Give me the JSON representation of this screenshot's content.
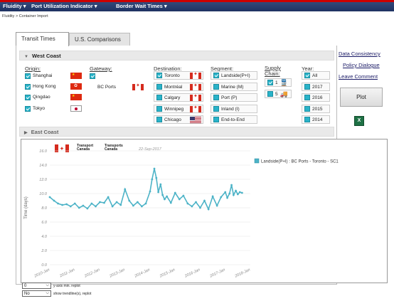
{
  "nav": {
    "menus": [
      "Fluidity ▾",
      "Port Utilization Indicator ▾",
      "Border Wait Times ▾"
    ]
  },
  "breadcrumb": "Fluidity > Container Import",
  "tabs": [
    "Transit Times",
    "U.S. Comparisons"
  ],
  "sections": {
    "west": "West Coast",
    "east": "East Coast"
  },
  "columns": {
    "origin": "Origin:",
    "gateway": "Gateway:",
    "destination": "Destination:",
    "segment": "Segment:",
    "supply": "Supply Chain:",
    "year": "Year:"
  },
  "origins": [
    {
      "label": "Shanghai",
      "checked": true,
      "flag": "china-flag"
    },
    {
      "label": "Hong Kong",
      "checked": true,
      "flag": "hong-kong-flag"
    },
    {
      "label": "Qingdao",
      "checked": true,
      "flag": "china-flag"
    },
    {
      "label": "Tokyo",
      "checked": true,
      "flag": "japan-flag"
    }
  ],
  "gateway": {
    "label": "BC Ports",
    "checked": true,
    "flag": "canada-flag"
  },
  "destinations": [
    {
      "label": "Toronto",
      "checked": true,
      "flag": "canada-flag"
    },
    {
      "label": "Montréal",
      "checked": false,
      "flag": "canada-flag"
    },
    {
      "label": "Calgary",
      "checked": false,
      "flag": "canada-flag"
    },
    {
      "label": "Winnipeg",
      "checked": false,
      "flag": "canada-flag"
    },
    {
      "label": "Chicago",
      "checked": false,
      "flag": "us-flag"
    }
  ],
  "segments": [
    {
      "label": "Landside(P+I)",
      "checked": true
    },
    {
      "label": "Marine (M)",
      "checked": false
    },
    {
      "label": "Port (P)",
      "checked": false
    },
    {
      "label": "Inland (I)",
      "checked": false
    },
    {
      "label": "End-to-End",
      "checked": false
    }
  ],
  "supply": [
    {
      "label": "1",
      "checked": true,
      "icon": "train-icon"
    },
    {
      "label": "5",
      "checked": false,
      "icon": "truck-icon"
    }
  ],
  "years": [
    {
      "label": "All",
      "checked": true
    },
    {
      "label": "2017",
      "checked": false
    },
    {
      "label": "2016",
      "checked": false
    },
    {
      "label": "2015",
      "checked": false
    },
    {
      "label": "2014",
      "checked": false
    }
  ],
  "side": {
    "links": [
      "Data Consistency",
      "Policy Dialogue",
      "Leave Comment"
    ],
    "plot": "Plot",
    "excel": "X"
  },
  "chart_header": {
    "tc_en": "Transport\nCanada",
    "tc_fr": "Transports\nCanada",
    "date": "22-Sep-2017"
  },
  "controls": {
    "ymin_value": "0",
    "ymin_label": "y-axis min. replot",
    "trend_value": "No",
    "trend_label": "show trendline(s), replot"
  },
  "chart_data": {
    "type": "line",
    "ylabel": "Time (days)",
    "ylim": [
      0,
      16
    ],
    "yticks": [
      "0.0",
      "2.0",
      "4.0",
      "6.0",
      "8.0",
      "10.0",
      "12.0",
      "14.0",
      "16.0"
    ],
    "xticks": [
      "2010-Jan",
      "2011-Jan",
      "2012-Jan",
      "2013-Jan",
      "2014-Jan",
      "2015-Jan",
      "2016-Jan",
      "2017-Jan",
      "2018-Jan"
    ],
    "xlim": [
      2010.0,
      2018.0
    ],
    "series": [
      {
        "name": "Landside(P+I) : BC Ports - Toronto - SC1",
        "color": "#4db3c7",
        "x": [
          2010.0,
          2010.17,
          2010.33,
          2010.5,
          2010.67,
          2010.83,
          2011.0,
          2011.17,
          2011.33,
          2011.5,
          2011.67,
          2011.83,
          2012.0,
          2012.17,
          2012.33,
          2012.5,
          2012.67,
          2012.83,
          2013.0,
          2013.17,
          2013.33,
          2013.5,
          2013.67,
          2013.83,
          2014.0,
          2014.08,
          2014.17,
          2014.25,
          2014.33,
          2014.42,
          2014.5,
          2014.58,
          2014.67,
          2014.83,
          2015.0,
          2015.17,
          2015.33,
          2015.5,
          2015.67,
          2015.83,
          2016.0,
          2016.17,
          2016.33,
          2016.5,
          2016.67,
          2016.83,
          2017.0,
          2017.08,
          2017.17,
          2017.25,
          2017.33,
          2017.42,
          2017.5,
          2017.58,
          2017.67
        ],
        "y": [
          9.5,
          9.0,
          8.6,
          8.4,
          8.5,
          8.2,
          8.6,
          8.0,
          8.3,
          7.9,
          8.6,
          8.2,
          8.8,
          8.7,
          9.5,
          8.2,
          8.8,
          8.4,
          10.6,
          9.0,
          8.3,
          8.8,
          8.2,
          8.6,
          10.3,
          12.0,
          13.5,
          12.2,
          10.2,
          11.3,
          9.8,
          9.2,
          9.6,
          8.7,
          10.1,
          9.2,
          9.7,
          8.6,
          8.2,
          8.8,
          8.0,
          9.0,
          7.8,
          9.6,
          8.3,
          9.5,
          10.2,
          9.4,
          10.0,
          11.2,
          9.8,
          10.4,
          9.9,
          10.2,
          10.1
        ]
      }
    ]
  }
}
